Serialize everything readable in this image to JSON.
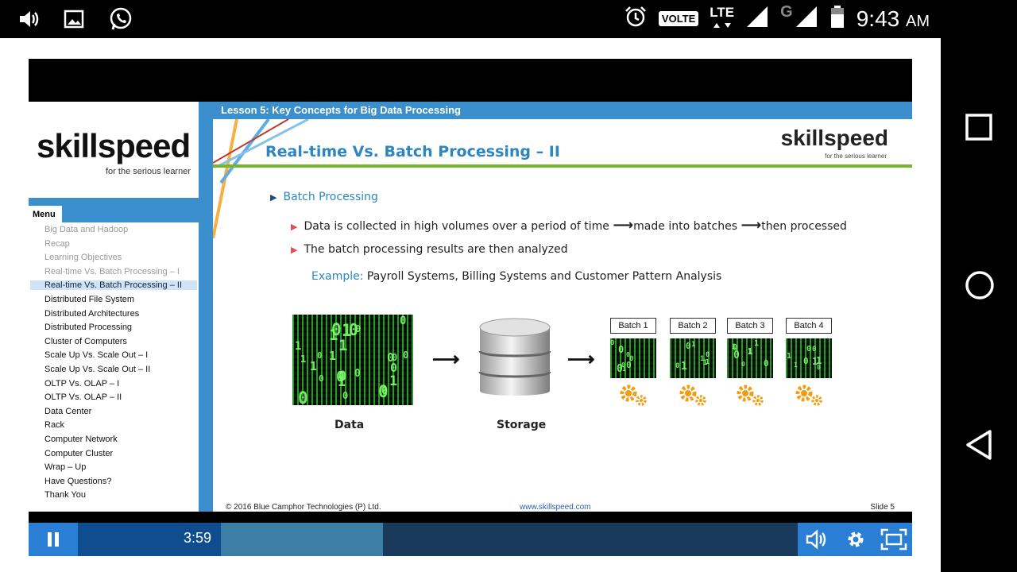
{
  "status_bar": {
    "icons": [
      "volume-icon",
      "gallery-icon",
      "whatsapp-icon",
      "alarm-icon",
      "volte-badge",
      "lte-signal-icon",
      "g-signal-icon",
      "battery-icon"
    ],
    "volte": "VOLTE",
    "lte": "LTE",
    "g": "G",
    "time": "9:43",
    "ampm": "AM"
  },
  "sidebar": {
    "logo": "skillspeed",
    "tagline": "for the serious learner",
    "menu_title": "Menu",
    "items": [
      {
        "label": "Big Data and Hadoop",
        "state": "visited"
      },
      {
        "label": "Recap",
        "state": "visited"
      },
      {
        "label": "Learning Objectives",
        "state": "visited"
      },
      {
        "label": "Real-time Vs. Batch Processing – I",
        "state": "visited"
      },
      {
        "label": "Real-time Vs. Batch Processing – II",
        "state": "active"
      },
      {
        "label": "Distributed File System",
        "state": "normal"
      },
      {
        "label": "Distributed Architectures",
        "state": "normal"
      },
      {
        "label": "Distributed Processing",
        "state": "normal"
      },
      {
        "label": "Cluster of Computers",
        "state": "normal"
      },
      {
        "label": "Scale Up Vs. Scale Out – I",
        "state": "normal"
      },
      {
        "label": "Scale Up Vs. Scale Out – II",
        "state": "normal"
      },
      {
        "label": "OLTP Vs. OLAP – I",
        "state": "normal"
      },
      {
        "label": "OLTP Vs. OLAP – II",
        "state": "normal"
      },
      {
        "label": "Data Center",
        "state": "normal"
      },
      {
        "label": "Rack",
        "state": "normal"
      },
      {
        "label": "Computer Network",
        "state": "normal"
      },
      {
        "label": "Computer Cluster",
        "state": "normal"
      },
      {
        "label": "Wrap – Up",
        "state": "normal"
      },
      {
        "label": "Have Questions?",
        "state": "normal"
      },
      {
        "label": "Thank You",
        "state": "normal"
      }
    ]
  },
  "slide": {
    "header": "Lesson 5: Key Concepts for Big Data Processing",
    "title": "Real-time Vs. Batch Processing – II",
    "logo": "skillspeed",
    "logo_tag": "for the serious learner",
    "bullet": "Batch Processing",
    "sub1_a": "Data is collected in high volumes over a period of time",
    "sub1_b": "made into batches",
    "sub1_c": "then processed",
    "sub2": "The batch processing results are then analyzed",
    "example_label": "Example:",
    "example_text": "Payroll Systems, Billing Systems and Customer Pattern Analysis",
    "data_caption": "Data",
    "storage_caption": "Storage",
    "batches": [
      "Batch 1",
      "Batch 2",
      "Batch 3",
      "Batch 4"
    ],
    "footer_copyright": "© 2016 Blue Camphor Technologies (P) Ltd.",
    "footer_url": "www.skillspeed.com",
    "footer_slide": "Slide 5"
  },
  "player": {
    "time": "3:59",
    "icons": [
      "pause-icon",
      "volume-icon",
      "settings-icon",
      "fullscreen-icon"
    ]
  },
  "colors": {
    "accent_blue": "#3b8fcc",
    "title_blue": "#2e86c1",
    "green_rule": "#76b82a",
    "gear_orange": "#f39c12"
  }
}
